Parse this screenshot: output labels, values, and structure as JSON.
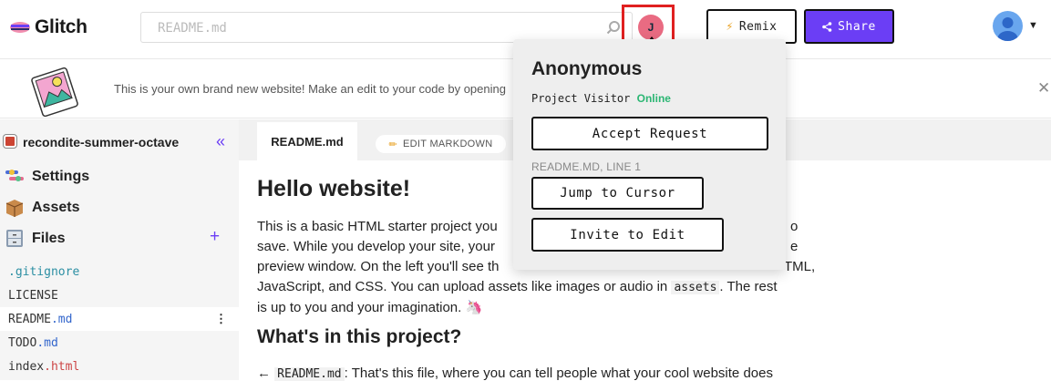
{
  "app": {
    "name": "Glitch"
  },
  "search": {
    "placeholder": "README.md"
  },
  "collaborator": {
    "initial": "J"
  },
  "toolbar": {
    "remix_label": "Remix",
    "share_label": "Share"
  },
  "banner": {
    "text": "This is your own brand new website! Make an edit to your code by opening"
  },
  "sidebar": {
    "project_name": "recondite-summer-octave",
    "collapse_glyph": "«",
    "items": [
      {
        "label": "Settings",
        "icon": "settings-icon"
      },
      {
        "label": "Assets",
        "icon": "assets-box-icon"
      },
      {
        "label": "Files",
        "icon": "files-cabinet-icon"
      }
    ],
    "add_glyph": "+",
    "files": [
      {
        "base": ".gitignore",
        "ext": ""
      },
      {
        "base": "LICENSE",
        "ext": ""
      },
      {
        "base": "README",
        "ext": ".md"
      },
      {
        "base": "TODO",
        "ext": ".md"
      },
      {
        "base": "index",
        "ext": ".html"
      }
    ]
  },
  "editor": {
    "tab_label": "README.md",
    "edit_markdown_label": "EDIT MARKDOWN",
    "heading": "Hello website!",
    "para_1": "This is a basic HTML starter project you",
    "para_1b": "save. While you develop your site, your",
    "para_1c": "preview window. On the left you'll see th",
    "para_2": "JavaScript, and CSS. You can upload assets like images or audio in",
    "para_2_code": "assets",
    "para_2_end": ". The rest",
    "para_3": "is up to you and your imagination.",
    "right_frag_1": "o",
    "right_frag_2": "e",
    "right_frag_3": "TML,",
    "heading_2": "What's in this project?",
    "line_arrow": "←",
    "line_code": "README.md",
    "line_rest": ": That's this file, where you can tell people what your cool website does"
  },
  "popover": {
    "name": "Anonymous",
    "role": "Project Visitor",
    "status": "Online",
    "accept_label": "Accept Request",
    "cursor_location": "README.MD, LINE 1",
    "jump_label": "Jump to Cursor",
    "invite_label": "Invite to Edit"
  },
  "colors": {
    "accent": "#6b3ef5",
    "online": "#2bb673",
    "highlight": "#e02020"
  }
}
